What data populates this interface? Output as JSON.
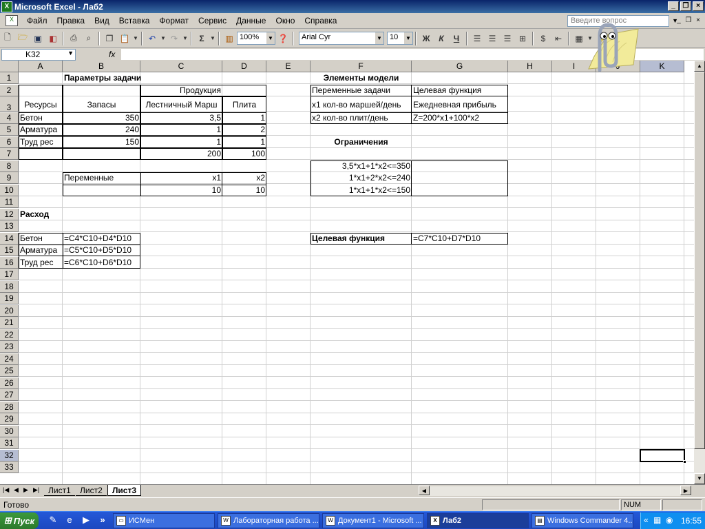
{
  "window": {
    "title": "Microsoft Excel - Лаб2"
  },
  "menu": [
    "Файл",
    "Правка",
    "Вид",
    "Вставка",
    "Формат",
    "Сервис",
    "Данные",
    "Окно",
    "Справка"
  ],
  "help_placeholder": "Введите вопрос",
  "toolbar": {
    "zoom": "100%",
    "font": "Arial Cyr",
    "size": "10"
  },
  "name_box": "K32",
  "fx": "fx",
  "columns": [
    "A",
    "B",
    "C",
    "D",
    "E",
    "F",
    "G",
    "H",
    "I",
    "J",
    "K"
  ],
  "rows": [
    "1",
    "2",
    "3",
    "4",
    "5",
    "6",
    "7",
    "8",
    "9",
    "10",
    "11",
    "12",
    "13",
    "14",
    "15",
    "16",
    "17",
    "18",
    "19",
    "20",
    "21",
    "22",
    "23",
    "24",
    "25",
    "26",
    "27",
    "28",
    "29",
    "30",
    "31",
    "32",
    "33"
  ],
  "cells": {
    "B1": "Параметры задачи",
    "C2": "Продукция",
    "A3": "Ресурсы",
    "B3": "Запасы",
    "C3": "Лестничный Марш",
    "D3": "Плита",
    "A4": "Бетон",
    "B4": "350",
    "C4": "3,5",
    "D4": "1",
    "A5": "Арматура",
    "B5": "240",
    "C5": "1",
    "D5": "2",
    "A6": "Труд рес",
    "B6": "150",
    "C6": "1",
    "D6": "1",
    "C7": "200",
    "D7": "100",
    "B9": "Переменные",
    "C9": "x1",
    "D9": "x2",
    "C10": "10",
    "D10": "10",
    "A12": "Расход",
    "A14": "Бетон",
    "B14": "=C4*C10+D4*D10",
    "A15": "Арматура",
    "B15": "=C5*C10+D5*D10",
    "A16": "Труд рес",
    "B16": "=C6*C10+D6*D10",
    "F1": "Элементы модели",
    "F2": "Переменные задачи",
    "G2": "Целевая функция",
    "F3": "x1 кол-во маршей/день",
    "G3": "Ежедневная прибыль",
    "F4": "x2 кол-во плит/день",
    "G4": "Z=200*x1+100*x2",
    "F6": "Ограничения",
    "F8": "3,5*x1+1*x2<=350",
    "F9": "1*x1+2*x2<=240",
    "F10": "1*x1+1*x2<=150",
    "F14": "Целевая функция",
    "G14": "=C7*C10+D7*D10"
  },
  "sheets": [
    "Лист1",
    "Лист2",
    "Лист3"
  ],
  "status": {
    "ready": "Готово",
    "num": "NUM"
  },
  "taskbar": {
    "start": "Пуск",
    "tasks": [
      "ИСМен",
      "Лабораторная работа ...",
      "Документ1 - Microsoft ...",
      "Лаб2",
      "Windows Commander 4..."
    ],
    "clock": "16:55"
  }
}
